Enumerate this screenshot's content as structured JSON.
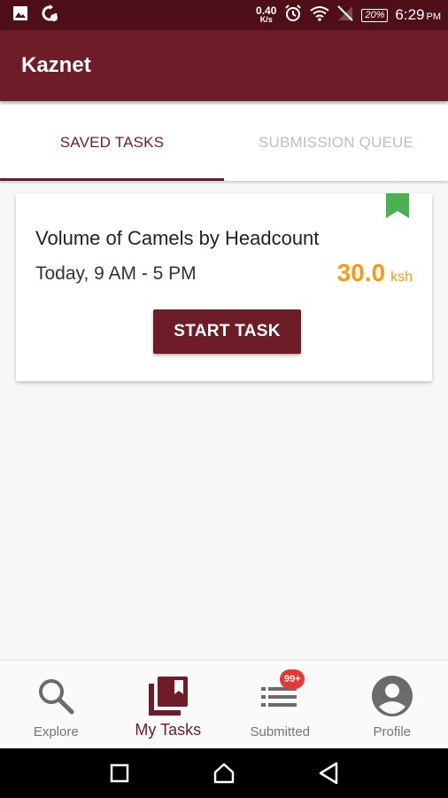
{
  "status_bar": {
    "net_speed_value": "0.40",
    "net_speed_unit": "K/s",
    "battery": "20%",
    "time": "6:29",
    "ampm": "PM"
  },
  "app_bar": {
    "title": "Kaznet"
  },
  "tabs": [
    {
      "label": "SAVED TASKS",
      "active": true
    },
    {
      "label": "SUBMISSION QUEUE",
      "active": false
    }
  ],
  "task": {
    "title": "Volume of Camels by Headcount",
    "time": "Today, 9 AM - 5 PM",
    "price_amount": "30.0",
    "price_currency": "ksh",
    "start_label": "START TASK",
    "bookmark_color": "#4caf50"
  },
  "bottom_nav": {
    "items": [
      {
        "label": "Explore",
        "icon": "search-icon"
      },
      {
        "label": "My Tasks",
        "icon": "library-icon",
        "active": true
      },
      {
        "label": "Submitted",
        "icon": "list-icon",
        "badge": "99+"
      },
      {
        "label": "Profile",
        "icon": "account-circle-icon"
      }
    ]
  },
  "colors": {
    "primary": "#6e1c27",
    "status_bar": "#4f0f18",
    "accent_price": "#f79a1a",
    "badge": "#e53935"
  }
}
